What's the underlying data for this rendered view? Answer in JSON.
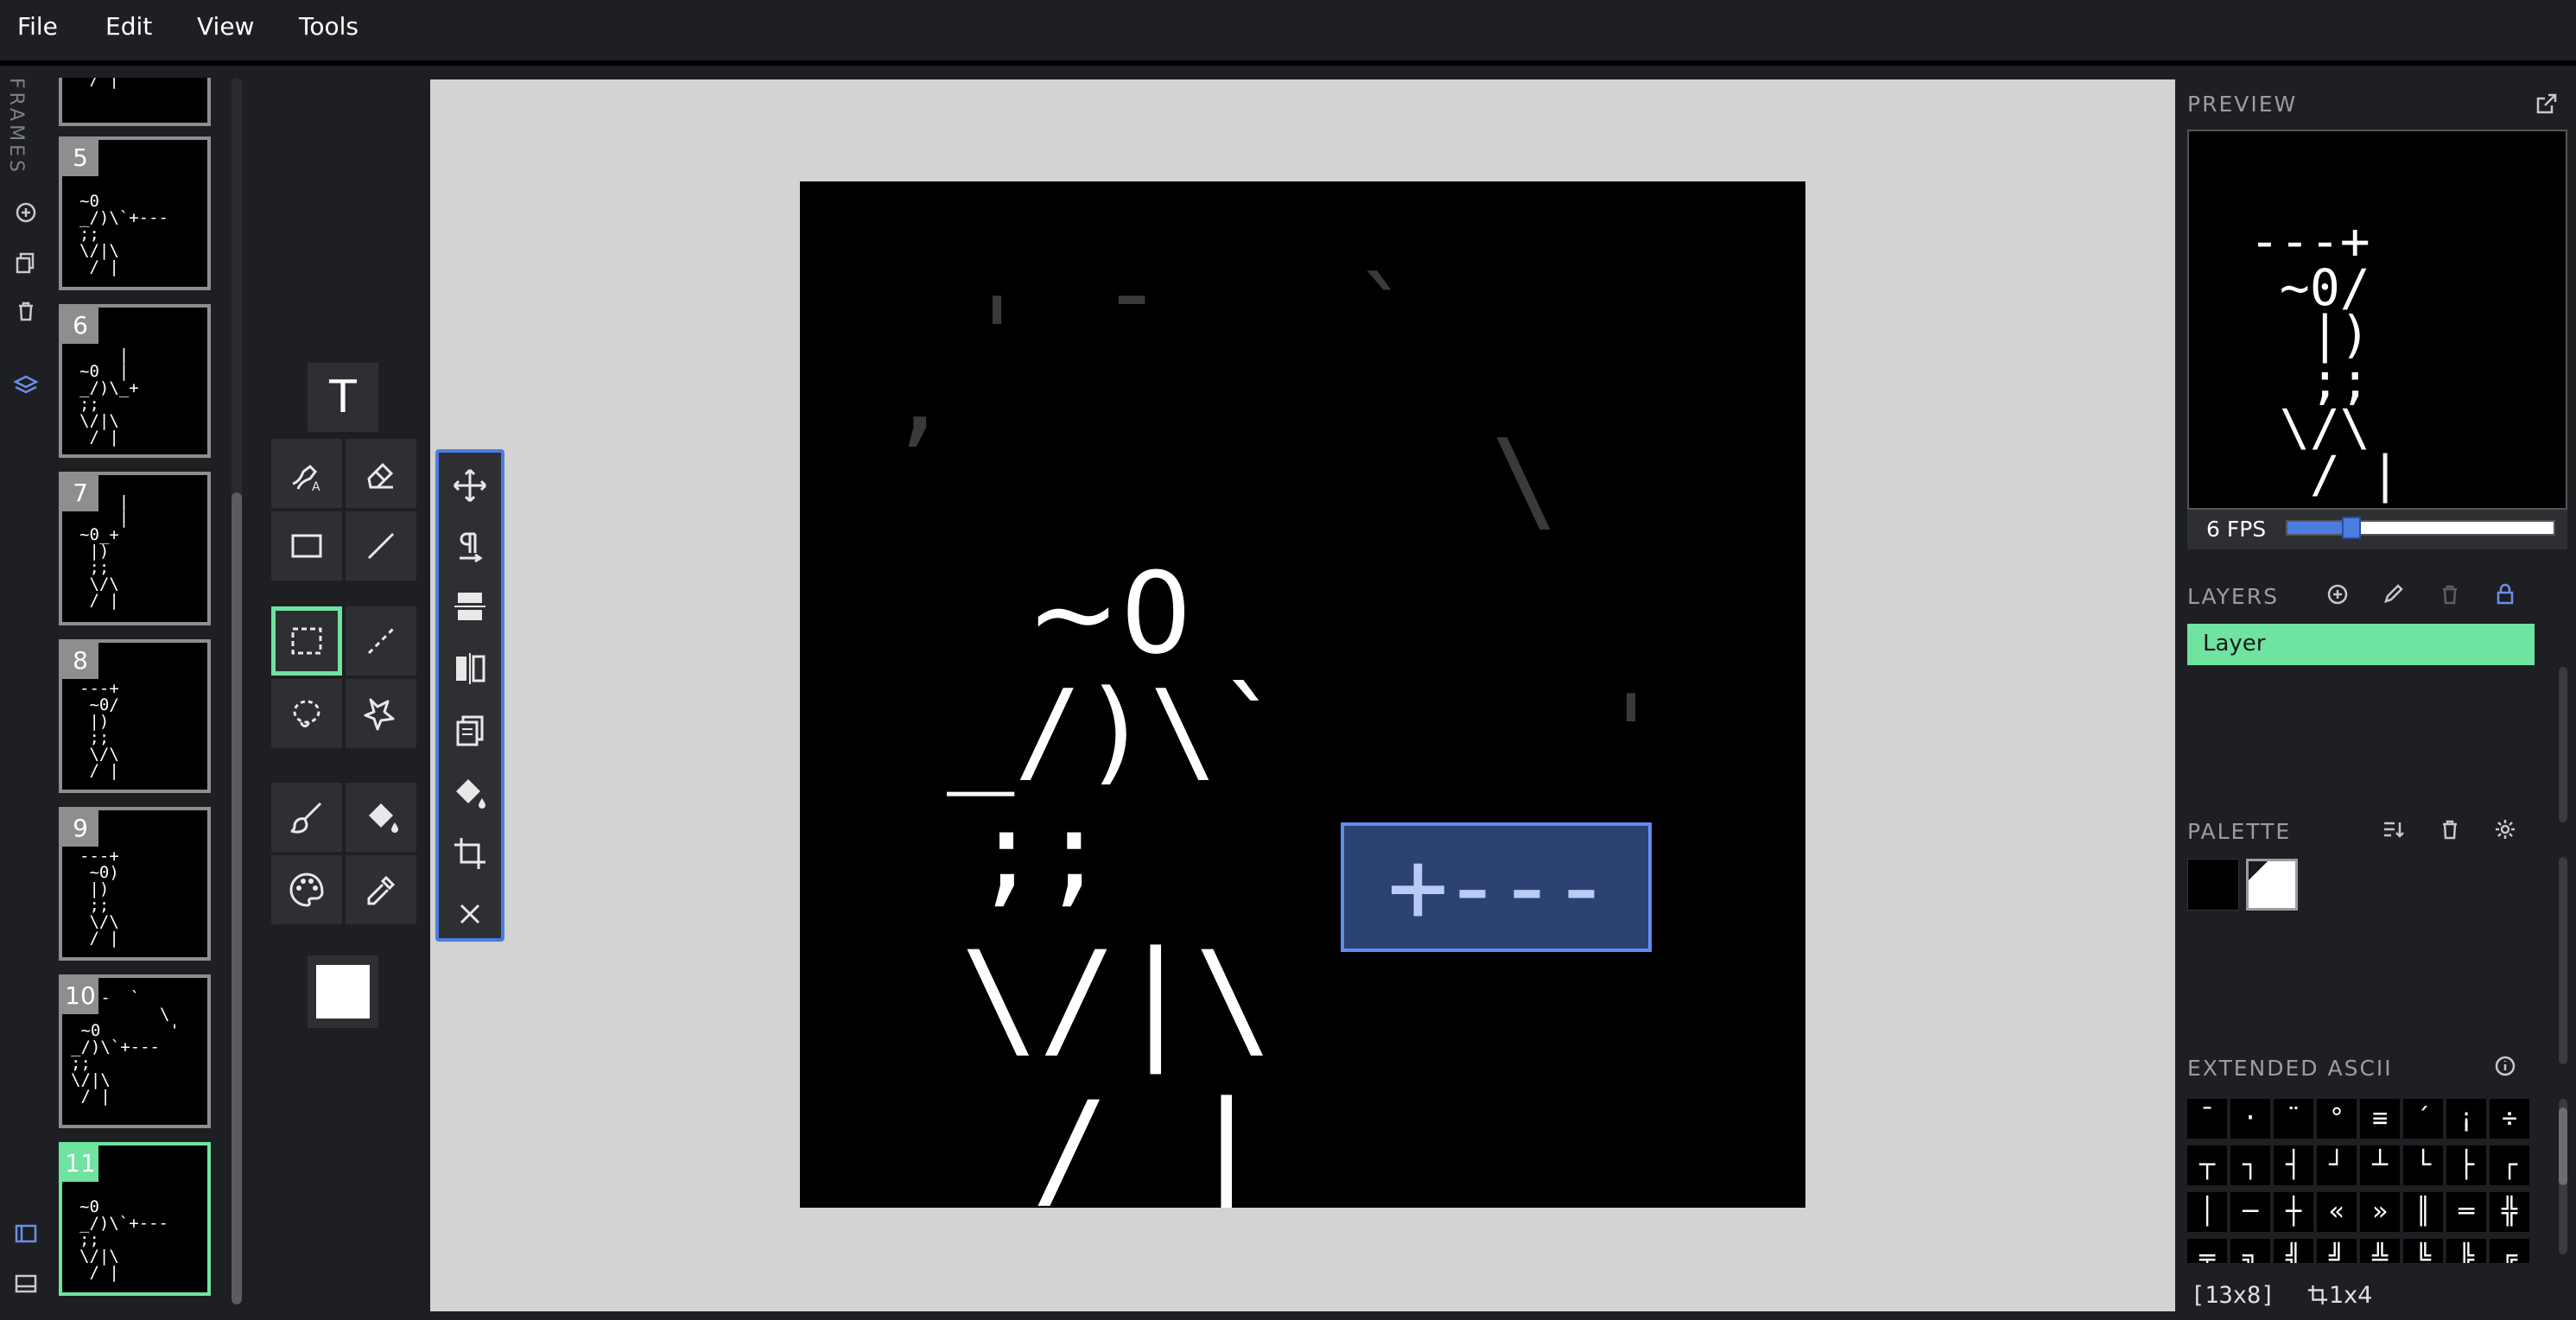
{
  "menu": {
    "file": "File",
    "edit": "Edit",
    "view": "View",
    "tools": "Tools"
  },
  "sidebar": {
    "frames_label": "FRAMES"
  },
  "frames": [
    {
      "num": "5",
      "art": "~0\n_/)\\`+---\n;;\n\\/|\\\n / |"
    },
    {
      "num": "6",
      "art": "    |\n~0  |\n_/)\\_+\n;;\n\\/|\\\n / |"
    },
    {
      "num": "7",
      "art": "    |\n    |\n~0_+\n |)\n ;;\n \\/\\\n / |"
    },
    {
      "num": "8",
      "art": "---+\n ~0/\n |)\n ;;\n \\/\\\n / |"
    },
    {
      "num": "9",
      "art": "---+\n ~0)\n |)\n ;;\n \\/\\\n / |"
    },
    {
      "num": "10",
      "art": "   -  `\n         \\\n ~0       '\n_/)\\`+---\n;;\n\\/|\\\n / |"
    },
    {
      "num": "11",
      "art": "~0\n_/)\\`+---\n;;\n\\/|\\\n / |"
    }
  ],
  "frames_top_partial": "\\/|\\\n / |",
  "tools": {
    "text_tool": "T"
  },
  "canvas": {
    "faded_glyphs": [
      ",",
      "'",
      "-",
      "`",
      "\\",
      "'"
    ],
    "row_head": "~0",
    "row_body": "_/)\\`",
    "row_legs1": ";;",
    "row_legs2": "\\/|\\",
    "row_feet": "/ |",
    "selection": "+---"
  },
  "preview": {
    "title": "PREVIEW",
    "art": "---+\n ~0/\n  |)\n  ;;\n \\/\\\n  / |",
    "fps_label": "6 FPS",
    "fps_value": 6,
    "fps_fraction": 0.24
  },
  "layers": {
    "title": "LAYERS",
    "items": [
      {
        "label": "Layer"
      }
    ]
  },
  "palette": {
    "title": "PALETTE",
    "colors": [
      "#000000",
      "#ffffff"
    ]
  },
  "extended_ascii": {
    "title": "EXTENDED ASCII",
    "chars": [
      "¯",
      "·",
      "¨",
      "°",
      "≡",
      "´",
      "¡",
      "÷",
      "┬",
      "┐",
      "┤",
      "┘",
      "┴",
      "└",
      "├",
      "┌",
      "│",
      "─",
      "┼",
      "«",
      "»",
      "║",
      "═",
      "╬",
      "╤",
      "╗",
      "╣",
      "╝",
      "╩",
      "╚",
      "╠",
      "╔"
    ]
  },
  "status": {
    "size": "[13x8]",
    "crop": "1x4"
  },
  "colors": {
    "accent": "#6fe3a0",
    "selection": "#4d7ce0"
  }
}
